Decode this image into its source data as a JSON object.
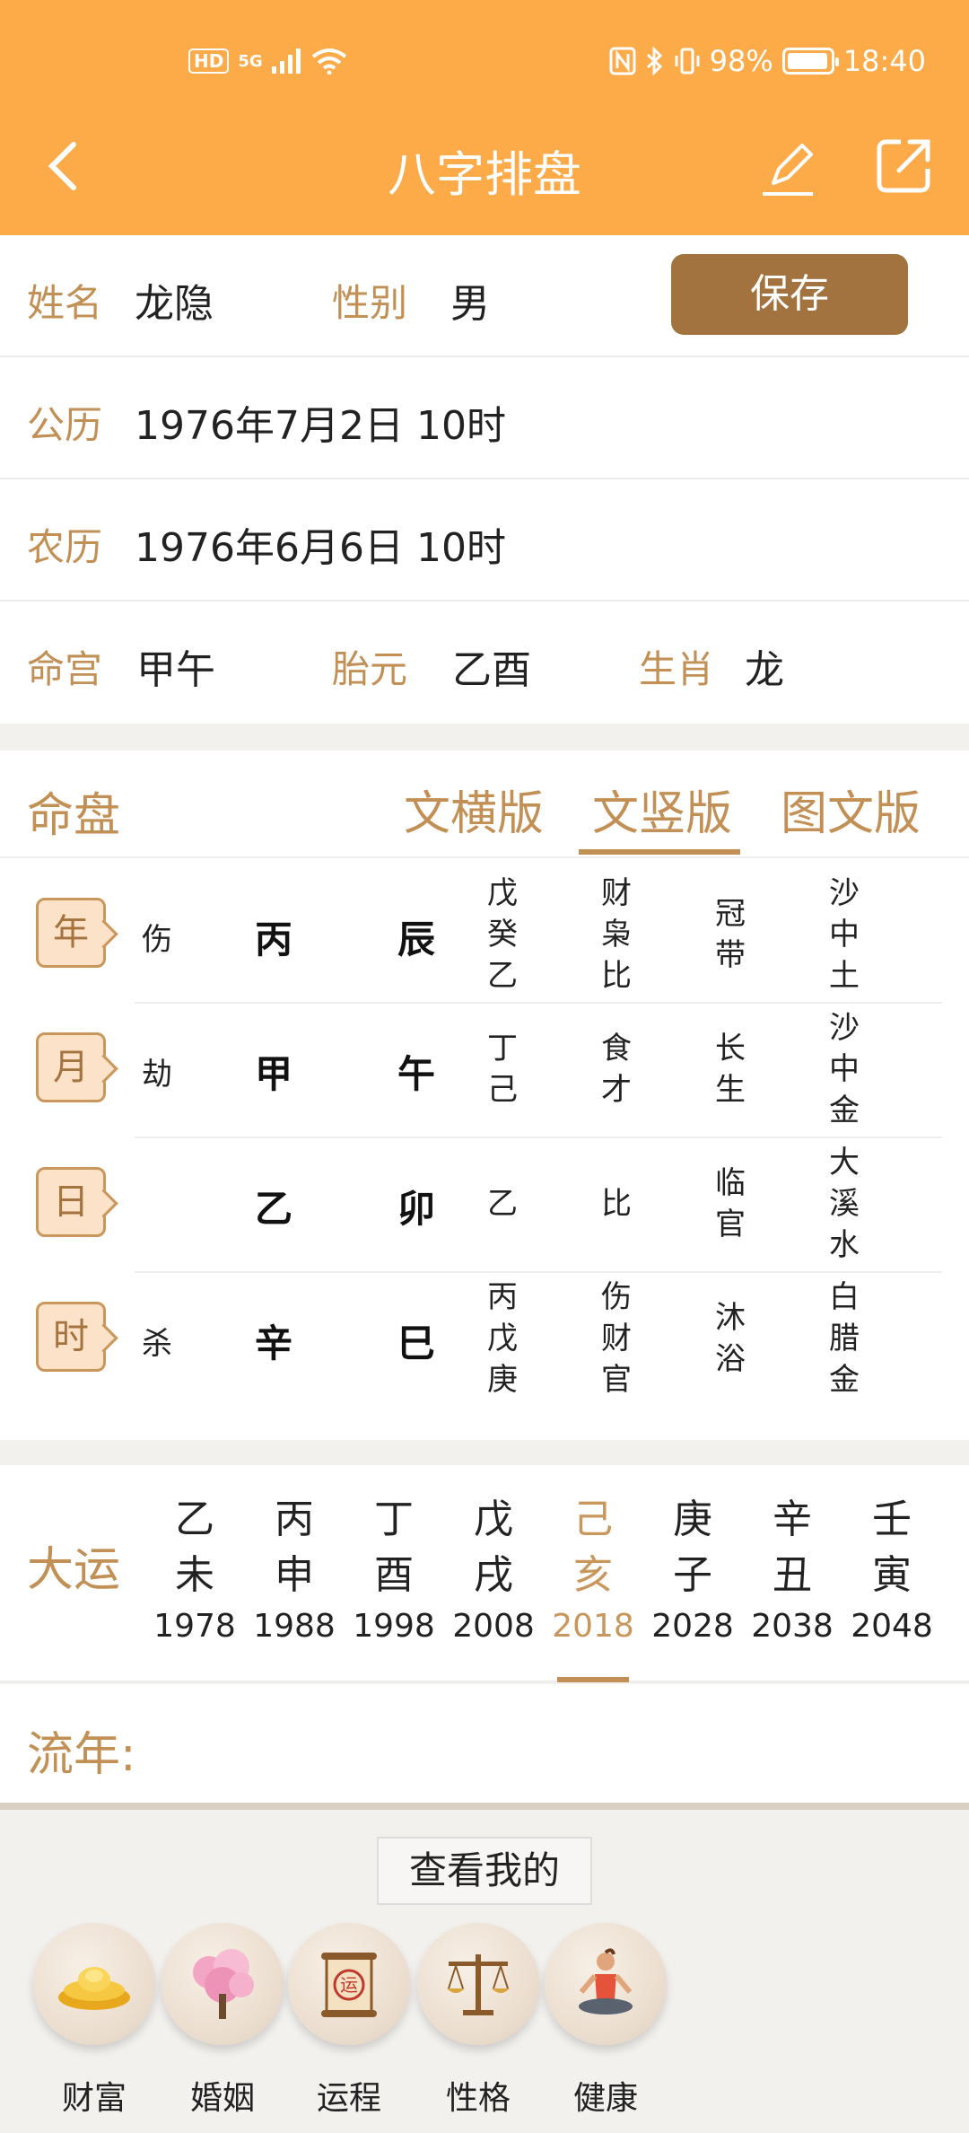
{
  "status": {
    "hd": "HD",
    "signal": "5G",
    "battery": "98%",
    "time": "18:40"
  },
  "header": {
    "title": "八字排盘"
  },
  "form": {
    "name_label": "姓名",
    "name_value": "龙隐",
    "gender_label": "性别",
    "gender_value": "男",
    "save_label": "保存",
    "solar_label": "公历",
    "solar_value": "1976年7月2日 10时",
    "lunar_label": "农历",
    "lunar_value": "1976年6月6日 10时",
    "minggong_label": "命宫",
    "minggong_value": "甲午",
    "taiyuan_label": "胎元",
    "taiyuan_value": "乙酉",
    "shengxiao_label": "生肖",
    "shengxiao_value": "龙"
  },
  "chart": {
    "title": "命盘",
    "tabs": [
      "文横版",
      "文竖版",
      "图文版"
    ],
    "active_tab": "文竖版",
    "pillars": [
      {
        "label": "年",
        "shishen": "伤",
        "gan": "丙",
        "zhi": "辰",
        "canggan": "戊\n癸\n乙",
        "canggan_shishen": "财\n枭\n比",
        "changsheng": "冠\n带",
        "nayin": "沙\n中\n土"
      },
      {
        "label": "月",
        "shishen": "劫",
        "gan": "甲",
        "zhi": "午",
        "canggan": "丁\n己",
        "canggan_shishen": "食\n才",
        "changsheng": "长\n生",
        "nayin": "沙\n中\n金"
      },
      {
        "label": "日",
        "shishen": "",
        "gan": "乙",
        "zhi": "卯",
        "canggan": "乙",
        "canggan_shishen": "比",
        "changsheng": "临\n官",
        "nayin": "大\n溪\n水"
      },
      {
        "label": "时",
        "shishen": "杀",
        "gan": "辛",
        "zhi": "巳",
        "canggan": "丙\n戊\n庚",
        "canggan_shishen": "伤\n财\n官",
        "changsheng": "沐\n浴",
        "nayin": "白\n腊\n金"
      }
    ]
  },
  "dayun": {
    "title": "大运",
    "items": [
      {
        "gan": "乙",
        "zhi": "未",
        "year": "1978"
      },
      {
        "gan": "丙",
        "zhi": "申",
        "year": "1988"
      },
      {
        "gan": "丁",
        "zhi": "酉",
        "year": "1998"
      },
      {
        "gan": "戊",
        "zhi": "戌",
        "year": "2008"
      },
      {
        "gan": "己",
        "zhi": "亥",
        "year": "2018"
      },
      {
        "gan": "庚",
        "zhi": "子",
        "year": "2028"
      },
      {
        "gan": "辛",
        "zhi": "丑",
        "year": "2038"
      },
      {
        "gan": "壬",
        "zhi": "寅",
        "year": "2048"
      }
    ],
    "active_year": "2018"
  },
  "liunian": {
    "title": "流年:"
  },
  "bottom": {
    "view_label": "查看我的",
    "features": [
      {
        "label": "财富",
        "icon": "gold-ingot-icon"
      },
      {
        "label": "婚姻",
        "icon": "blossom-tree-icon"
      },
      {
        "label": "运程",
        "icon": "scroll-fortune-icon"
      },
      {
        "label": "性格",
        "icon": "balance-scale-icon"
      },
      {
        "label": "健康",
        "icon": "meditation-icon"
      }
    ]
  },
  "colors": {
    "header": "#fdaa48",
    "label": "#c28f55",
    "save": "#a2733f",
    "active": "#c9975c"
  }
}
